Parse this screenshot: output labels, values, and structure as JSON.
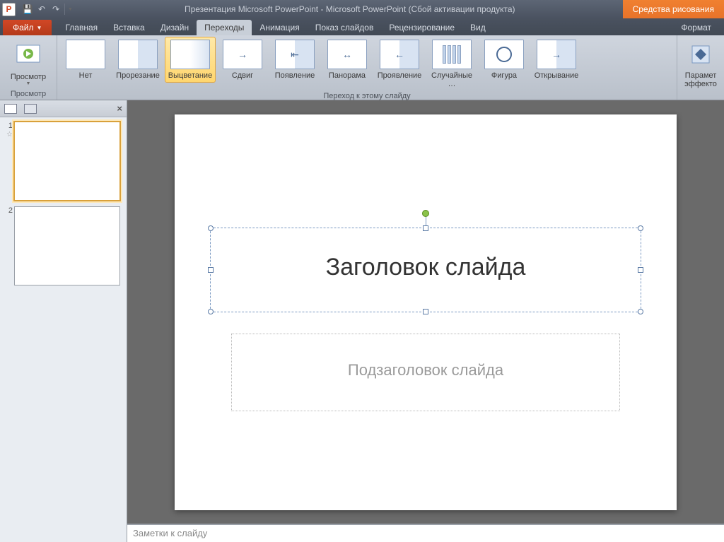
{
  "titlebar": {
    "title": "Презентация Microsoft PowerPoint  -  Microsoft PowerPoint (Сбой активации продукта)",
    "context_tab": "Средства рисования"
  },
  "qat": {
    "save": "💾",
    "undo": "↶",
    "redo": "↷"
  },
  "tabs": {
    "file": "Файл",
    "items": [
      "Главная",
      "Вставка",
      "Дизайн",
      "Переходы",
      "Анимация",
      "Показ слайдов",
      "Рецензирование",
      "Вид"
    ],
    "active_index": 3,
    "format": "Формат"
  },
  "ribbon": {
    "preview_group": "Просмотр",
    "preview": "Просмотр",
    "transitions_group": "Переход к этому слайду",
    "transitions": [
      "Нет",
      "Прорезание",
      "Выцветание",
      "Сдвиг",
      "Появление",
      "Панорама",
      "Проявление",
      "Случайные …",
      "Фигура",
      "Открывание"
    ],
    "selected_index": 2,
    "effect_options": "Парамет\nэффекто"
  },
  "thumbs": {
    "slides": [
      {
        "num": "1",
        "star": "☆"
      },
      {
        "num": "2",
        "star": ""
      }
    ],
    "selected": 0,
    "close": "×"
  },
  "slide": {
    "title": "Заголовок слайда",
    "subtitle": "Подзаголовок слайда"
  },
  "notes": {
    "placeholder": "Заметки к слайду"
  }
}
